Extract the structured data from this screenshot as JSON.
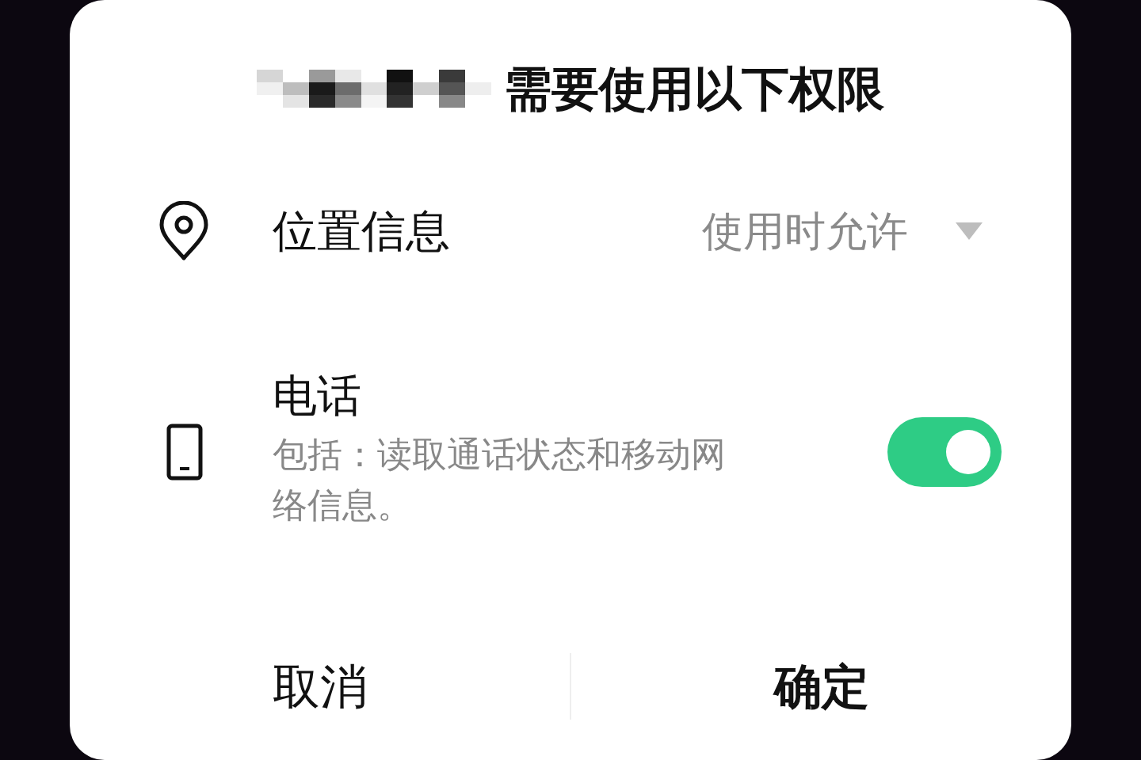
{
  "dialog": {
    "title": "需要使用以下权限",
    "permissions": [
      {
        "kind": "dropdown",
        "label": "位置信息",
        "value": "使用时允许"
      },
      {
        "kind": "toggle",
        "label": "电话",
        "description": "包括：读取通话状态和移动网络信息。",
        "on": true
      }
    ],
    "buttons": [
      {
        "label": "取消",
        "primary": false
      },
      {
        "label": "确定",
        "primary": true
      }
    ]
  }
}
